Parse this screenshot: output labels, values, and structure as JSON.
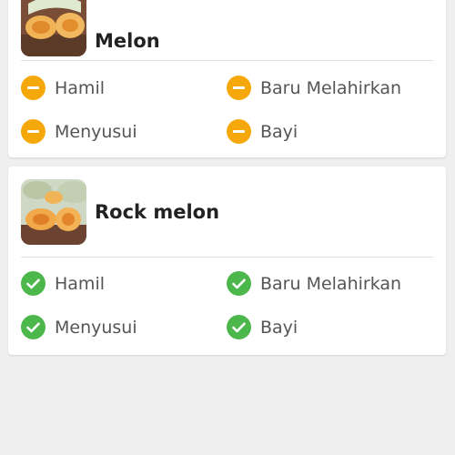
{
  "foods": [
    {
      "name": "Melon",
      "image_icon": "melon-photo",
      "statuses": [
        {
          "label": "Hamil",
          "state": "neutral"
        },
        {
          "label": "Baru Melahirkan",
          "state": "neutral"
        },
        {
          "label": "Menyusui",
          "state": "neutral"
        },
        {
          "label": "Bayi",
          "state": "neutral"
        }
      ]
    },
    {
      "name": "Rock melon",
      "image_icon": "rock-melon-photo",
      "statuses": [
        {
          "label": "Hamil",
          "state": "ok"
        },
        {
          "label": "Baru Melahirkan",
          "state": "ok"
        },
        {
          "label": "Menyusui",
          "state": "ok"
        },
        {
          "label": "Bayi",
          "state": "ok"
        }
      ]
    }
  ],
  "colors": {
    "neutral": "#f5a80a",
    "ok": "#4cb84c",
    "background": "#efefef"
  }
}
